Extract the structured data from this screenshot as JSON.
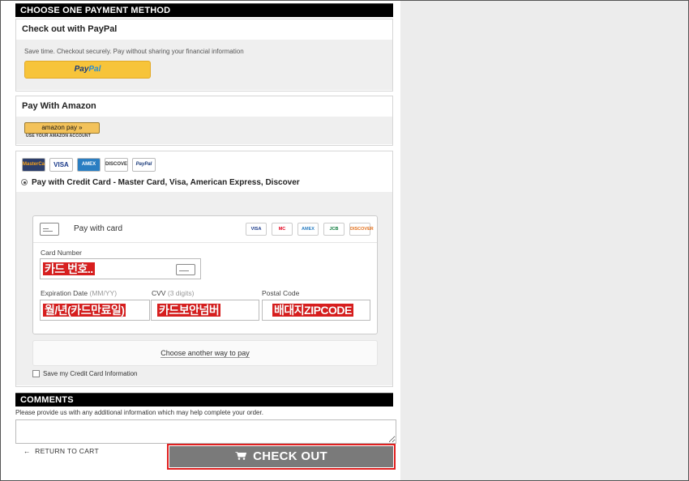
{
  "payment": {
    "header": "CHOOSE ONE PAYMENT METHOD",
    "paypal": {
      "title": "Check out with PayPal",
      "note": "Save time. Checkout securely. Pay without sharing your financial information",
      "btn_p1": "Pay",
      "btn_p2": "Pal"
    },
    "amazon": {
      "title": "Pay With Amazon",
      "btn": "amazon pay",
      "sub": "USE YOUR AMAZON ACCOUNT"
    },
    "credit": {
      "cards": [
        "MasterCard",
        "VISA",
        "AMEX",
        "DISCOVER",
        "PayPal"
      ],
      "radio_label": "Pay with Credit Card - Master Card, Visa, American Express, Discover",
      "title": "Pay with card",
      "brands": [
        "VISA",
        "MC",
        "AMEX",
        "JCB",
        "DISCOVER"
      ],
      "card_number_label": "Card Number",
      "card_number_value": "카드 번호..",
      "exp_label": "Expiration Date",
      "exp_hint": "(MM/YY)",
      "exp_value": "월/년(카드만료일)",
      "cvv_label": "CVV",
      "cvv_hint": "(3 digits)",
      "cvv_value": "카드보안넘버",
      "postal_label": "Postal Code",
      "postal_value": "배대지ZIPCODE",
      "another": "Choose another way to pay",
      "save": "Save my Credit Card Information"
    }
  },
  "comments": {
    "header": "COMMENTS",
    "note": "Please provide us with any additional information which may help complete your order.",
    "value": ""
  },
  "footer": {
    "return": "RETURN TO CART",
    "checkout": "CHECK OUT"
  }
}
